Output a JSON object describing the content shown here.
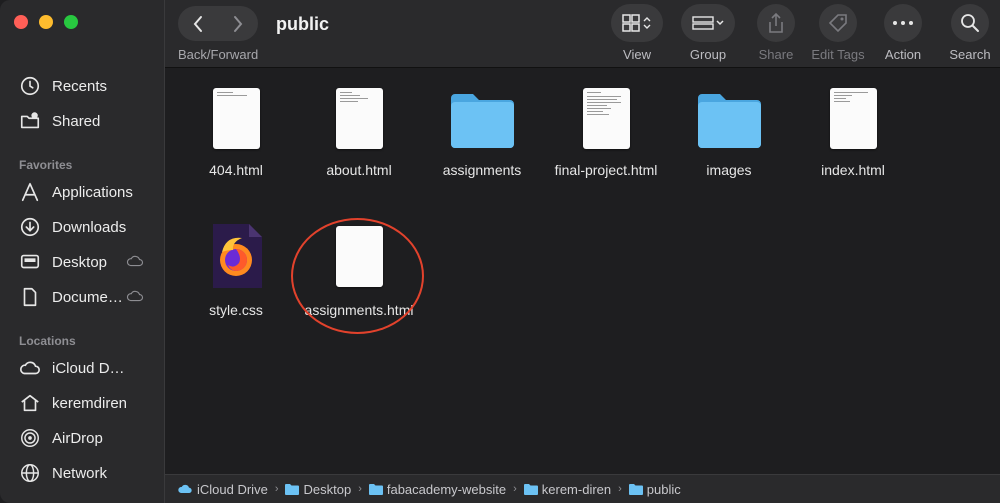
{
  "window": {
    "title": "public"
  },
  "toolbar": {
    "nav_label": "Back/Forward",
    "view_label": "View",
    "group_label": "Group",
    "share_label": "Share",
    "edit_tags_label": "Edit Tags",
    "action_label": "Action",
    "search_label": "Search"
  },
  "sidebar": {
    "items_top": [
      {
        "label": "Recents",
        "icon": "clock-icon"
      },
      {
        "label": "Shared",
        "icon": "shared-folder-icon"
      }
    ],
    "favorites_title": "Favorites",
    "favorites": [
      {
        "label": "Applications",
        "icon": "applications-icon"
      },
      {
        "label": "Downloads",
        "icon": "downloads-icon"
      },
      {
        "label": "Desktop",
        "icon": "desktop-icon"
      },
      {
        "label": "Docume…",
        "icon": "document-icon"
      }
    ],
    "locations_title": "Locations",
    "locations": [
      {
        "label": "iCloud D…",
        "icon": "icloud-icon"
      },
      {
        "label": "keremdiren",
        "icon": "home-icon"
      },
      {
        "label": "AirDrop",
        "icon": "airdrop-icon"
      },
      {
        "label": "Network",
        "icon": "network-icon"
      }
    ]
  },
  "files": [
    {
      "name": "404.html",
      "kind": "html"
    },
    {
      "name": "about.html",
      "kind": "html"
    },
    {
      "name": "assignments",
      "kind": "folder"
    },
    {
      "name": "final-project.html",
      "kind": "html"
    },
    {
      "name": "images",
      "kind": "folder"
    },
    {
      "name": "index.html",
      "kind": "html"
    },
    {
      "name": "style.css",
      "kind": "css"
    },
    {
      "name": "assignments.html",
      "kind": "html-blank"
    }
  ],
  "statusbar": {
    "path": [
      "iCloud Drive",
      "Desktop",
      "fabacademy-website",
      "kerem-diren",
      "public"
    ],
    "separator": "›"
  },
  "colors": {
    "folder": "#5cb8f0",
    "annotation": "#e2422c",
    "sidebar": "#2a2a2c",
    "content": "#1e1e20"
  }
}
